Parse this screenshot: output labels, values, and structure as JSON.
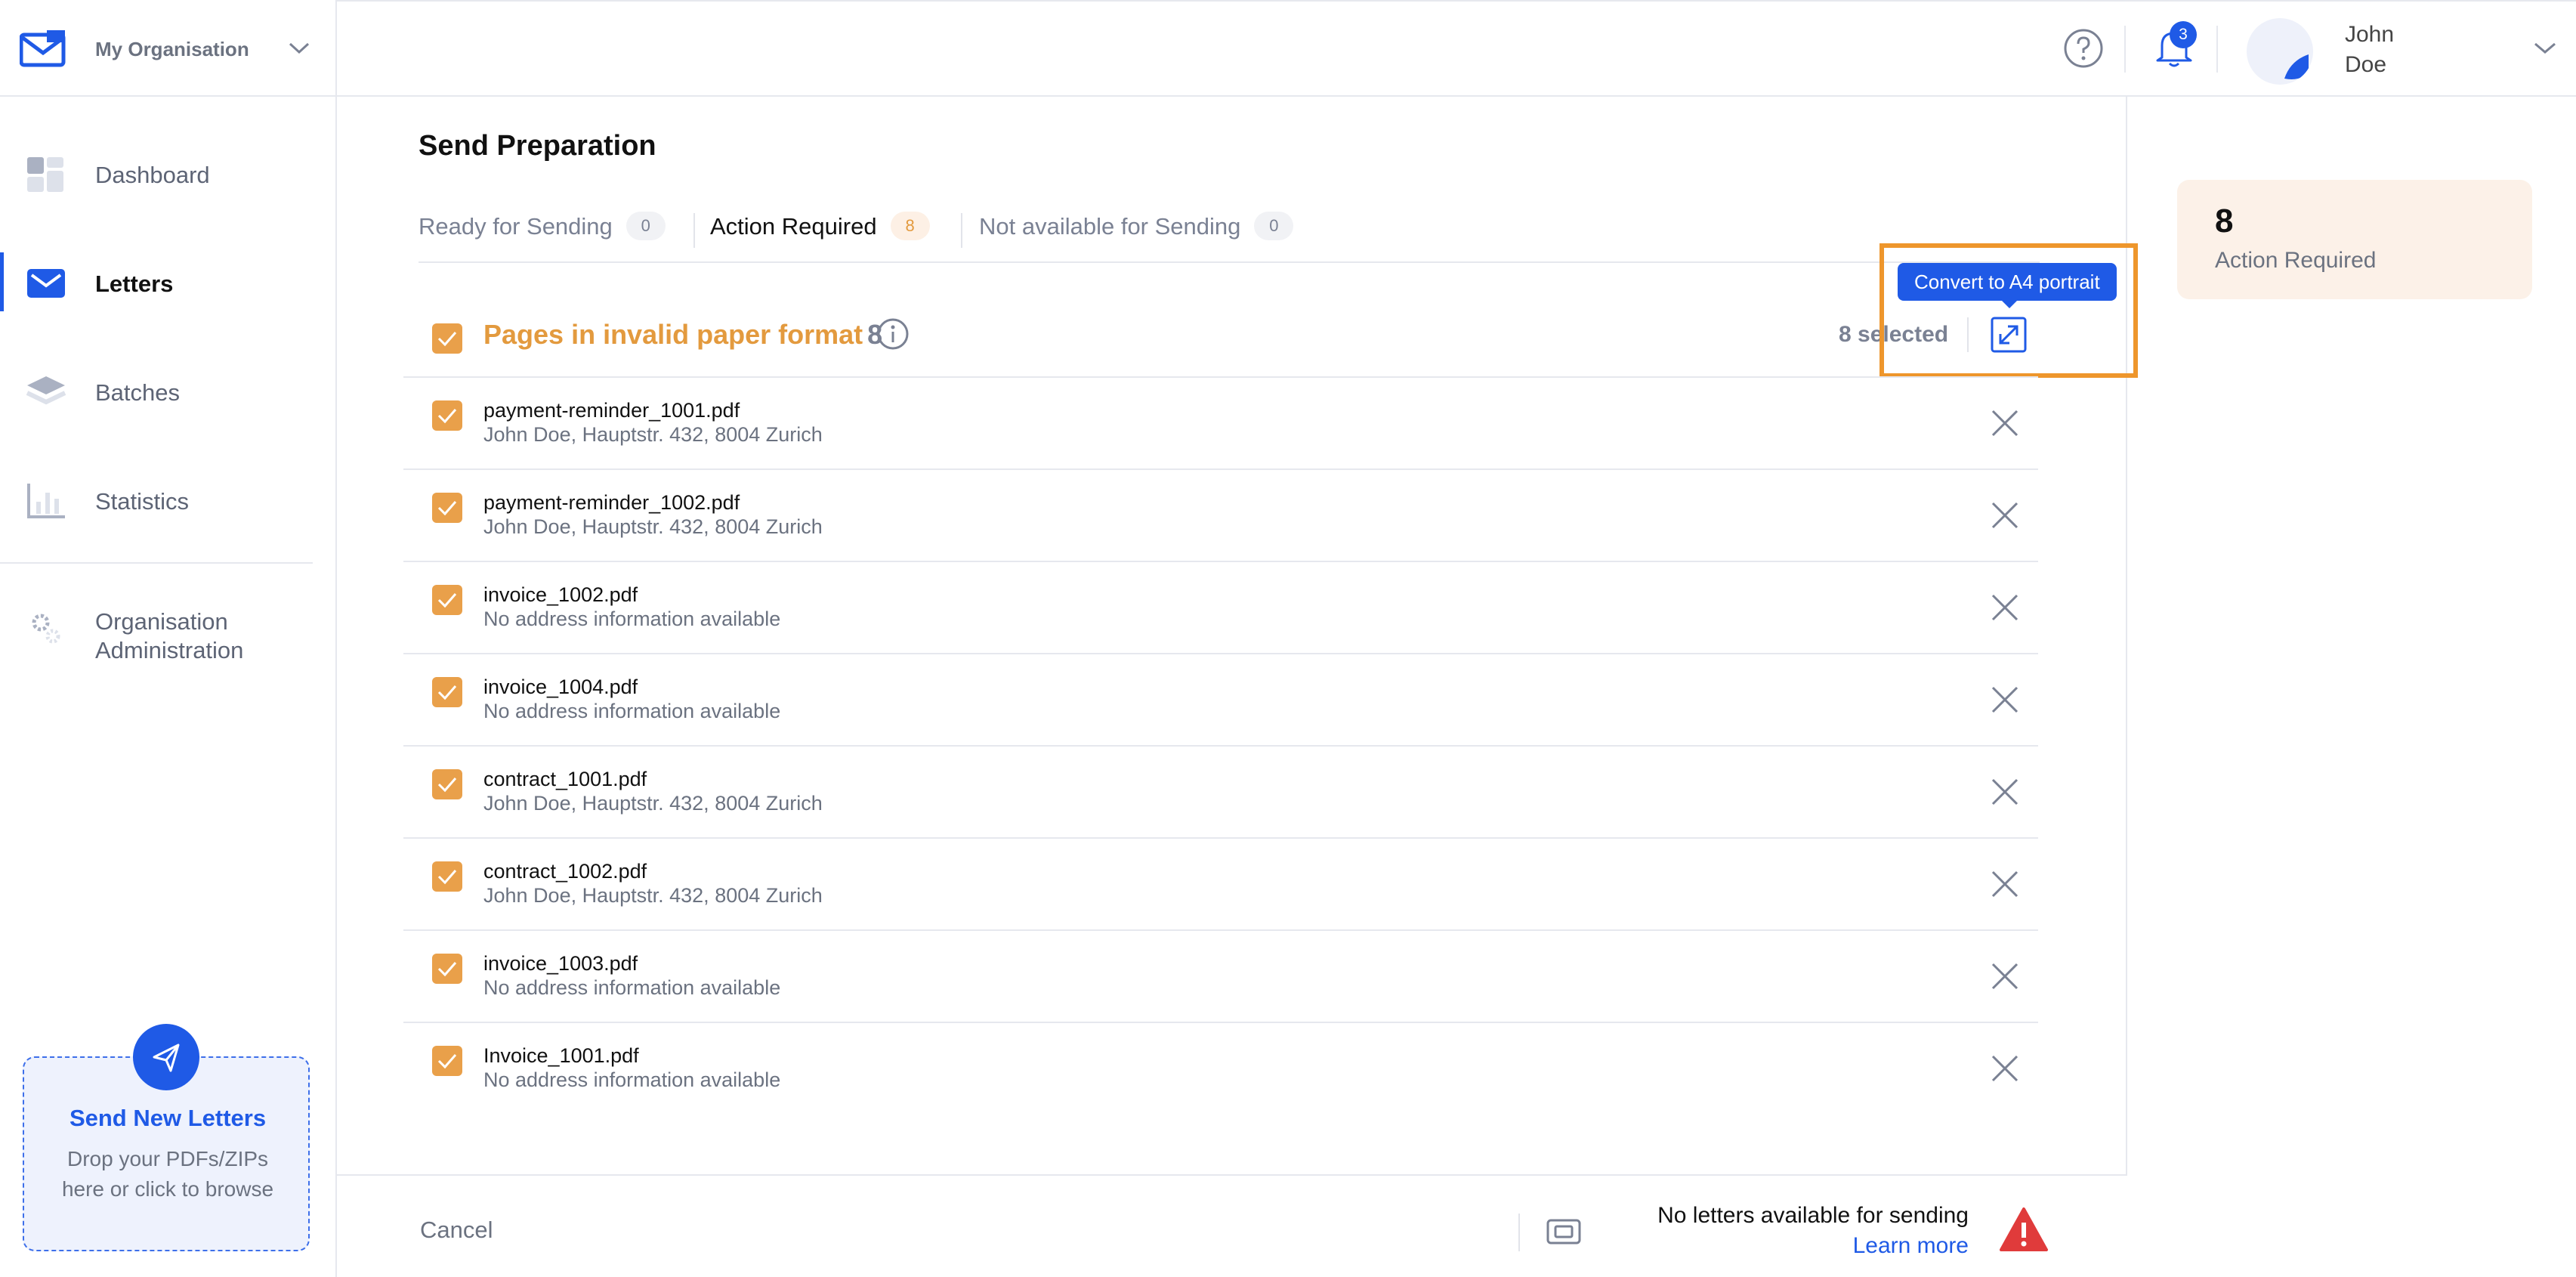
{
  "org": {
    "name": "My Organisation"
  },
  "sidebar": {
    "items": [
      {
        "label": "Dashboard"
      },
      {
        "label": "Letters"
      },
      {
        "label": "Batches"
      },
      {
        "label": "Statistics"
      },
      {
        "label": "Organisation Administration"
      }
    ],
    "drop": {
      "title": "Send New Letters",
      "subtitle": "Drop your PDFs/ZIPs here or click to browse"
    }
  },
  "topbar": {
    "notifications_count": "3",
    "user_first": "John",
    "user_last": "Doe"
  },
  "main": {
    "title": "Send Preparation",
    "tabs": [
      {
        "label": "Ready for Sending",
        "count": "0"
      },
      {
        "label": "Action Required",
        "count": "8"
      },
      {
        "label": "Not available for Sending",
        "count": "0"
      }
    ],
    "group": {
      "title": "Pages in invalid paper format",
      "count": "8",
      "selected": "8 selected",
      "tooltip": "Convert to A4 portrait"
    },
    "rows": [
      {
        "file": "payment-reminder_1001.pdf",
        "address": "John Doe, Hauptstr. 432, 8004 Zurich"
      },
      {
        "file": "payment-reminder_1002.pdf",
        "address": "John Doe, Hauptstr. 432, 8004 Zurich"
      },
      {
        "file": "invoice_1002.pdf",
        "address": "No address information available"
      },
      {
        "file": "invoice_1004.pdf",
        "address": "No address information available"
      },
      {
        "file": "contract_1001.pdf",
        "address": "John Doe, Hauptstr. 432, 8004 Zurich"
      },
      {
        "file": "contract_1002.pdf",
        "address": "John Doe, Hauptstr. 432, 8004 Zurich"
      },
      {
        "file": "invoice_1003.pdf",
        "address": "No address information available"
      },
      {
        "file": "Invoice_1001.pdf",
        "address": "No address information available"
      }
    ]
  },
  "footer": {
    "cancel": "Cancel",
    "message": "No letters available for sending",
    "link": "Learn more"
  },
  "summary": {
    "count": "8",
    "label": "Action Required"
  },
  "colors": {
    "accent": "#1f5ae6",
    "warning": "#e39a3e",
    "danger": "#e03b3b"
  }
}
